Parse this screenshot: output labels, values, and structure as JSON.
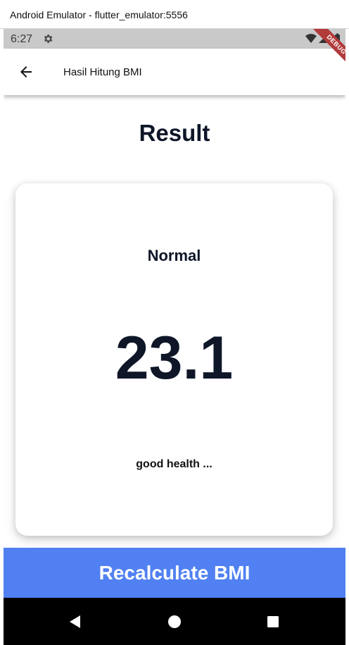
{
  "window": {
    "title": "Android Emulator - flutter_emulator:5556"
  },
  "status_bar": {
    "time": "6:27",
    "icons": [
      "gear-icon",
      "wifi-icon",
      "signal-icon",
      "battery-icon"
    ]
  },
  "debug_banner": {
    "label": "DEBUG"
  },
  "app_bar": {
    "back_icon": "arrow-left-icon",
    "title": "Hasil Hitung BMI"
  },
  "page": {
    "title": "Result"
  },
  "result": {
    "category": "Normal",
    "bmi_value": "23.1",
    "message": "good health ..."
  },
  "recalculate_button": {
    "label": "Recalculate BMI"
  },
  "nav_bar": {
    "items": [
      "back-triangle-icon",
      "home-circle-icon",
      "recents-square-icon"
    ]
  },
  "colors": {
    "primary_text": "#0e1628",
    "button_blue": "#5080f2",
    "status_bar_gray": "#c9c9c9",
    "debug_red": "#b23a3a"
  }
}
